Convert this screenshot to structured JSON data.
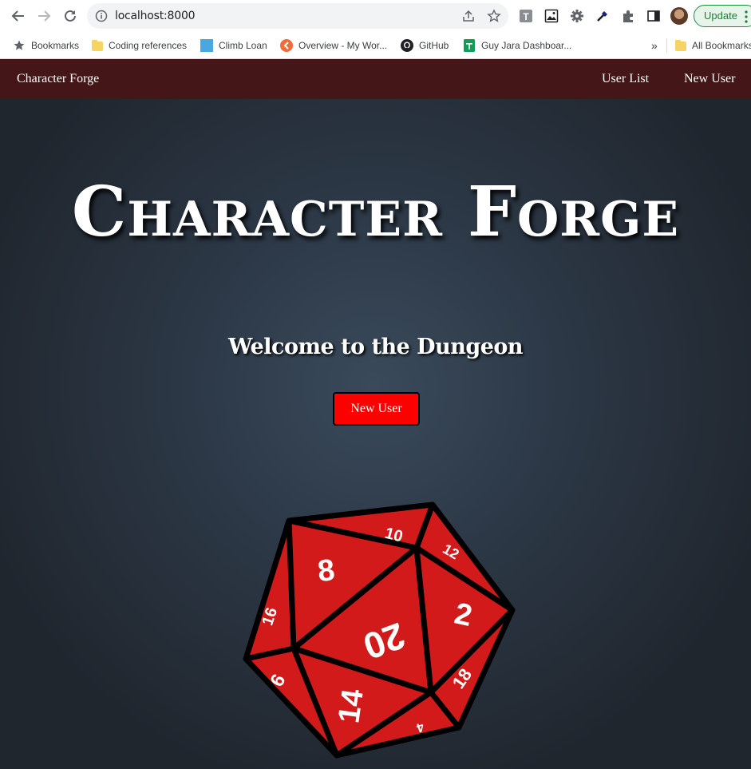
{
  "browser": {
    "url": "localhost:8000",
    "update_label": "Update",
    "bookmarks": [
      {
        "label": "Bookmarks",
        "icon": "star-icon"
      },
      {
        "label": "Coding references",
        "icon": "folder-icon"
      },
      {
        "label": "Climb Loan",
        "icon": "blue-square-icon"
      },
      {
        "label": "Overview - My Wor...",
        "icon": "orange-logo-icon"
      },
      {
        "label": "GitHub",
        "icon": "github-icon"
      },
      {
        "label": "Guy Jara Dashboar...",
        "icon": "green-sheet-icon"
      }
    ],
    "overflow_label": "»",
    "all_bookmarks_label": "All Bookmarks"
  },
  "site": {
    "brand": "Character Forge",
    "nav_links": [
      "User List",
      "New User"
    ],
    "hero_title": "Character Forge",
    "welcome": "Welcome to the Dungeon",
    "cta_label": "New User",
    "dice_numbers": [
      "10",
      "12",
      "8",
      "20",
      "2",
      "16",
      "6",
      "14",
      "18",
      "4"
    ]
  },
  "colors": {
    "navbar": "#451617",
    "cta": "#ff0000",
    "dice_face": "#d31a1a"
  }
}
